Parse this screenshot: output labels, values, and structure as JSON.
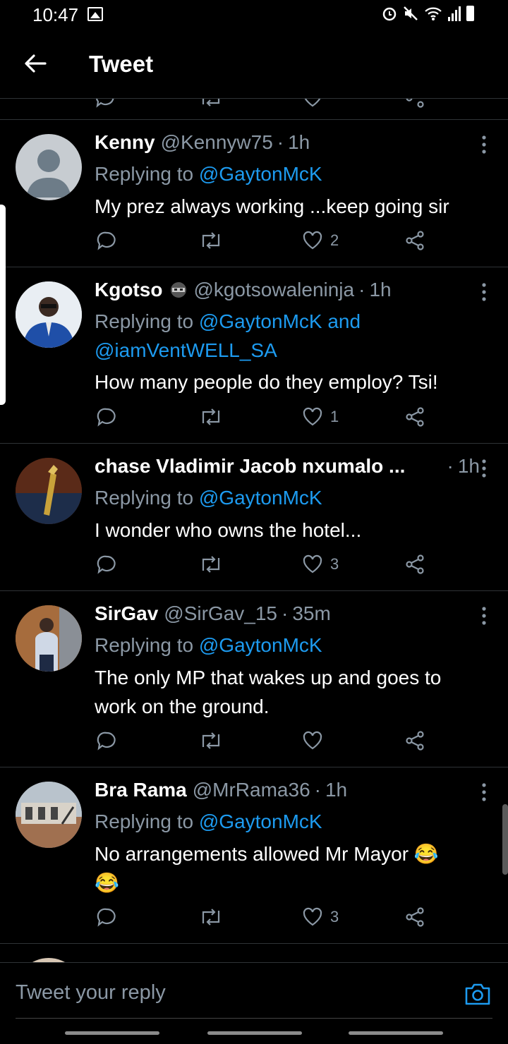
{
  "status_bar": {
    "time": "10:47"
  },
  "header": {
    "title": "Tweet"
  },
  "tweets": [
    {
      "name": "Kenny",
      "handle": "@Kennyw75",
      "time": "1h",
      "replying_prefix": "Replying to ",
      "mentions": "@GaytonMcK",
      "mentions2": "",
      "text": "My prez always working ...keep going sir",
      "text2": "",
      "likes": "2"
    },
    {
      "name": "Kgotso",
      "handle": "@kgotsowaleninja",
      "time": "1h",
      "replying_prefix": "Replying to ",
      "mentions": "@GaytonMcK and",
      "mentions2": "@iamVentWELL_SA",
      "text": "How many people do they employ? Tsi!",
      "text2": "",
      "likes": "1"
    },
    {
      "name": "chase Vladimir Jacob nxumalo ...",
      "handle": "",
      "time": "1h",
      "replying_prefix": "Replying to ",
      "mentions": "@GaytonMcK",
      "mentions2": "",
      "text": "I wonder who owns the hotel...",
      "text2": "",
      "likes": "3"
    },
    {
      "name": "SirGav",
      "handle": "@SirGav_15",
      "time": "35m",
      "replying_prefix": "Replying to ",
      "mentions": "@GaytonMcK",
      "mentions2": "",
      "text": "The only MP that wakes up and goes to",
      "text2": "work on the ground.",
      "likes": ""
    },
    {
      "name": "Bra Rama",
      "handle": "@MrRama36",
      "time": "1h",
      "replying_prefix": "Replying to ",
      "mentions": "@GaytonMcK",
      "mentions2": "",
      "text": "No arrangements allowed Mr Mayor 😂",
      "text2": "😂",
      "likes": "3"
    }
  ],
  "reply_bar": {
    "placeholder": "Tweet your reply"
  },
  "icons": [
    "back-arrow-icon",
    "more-icon",
    "reply-icon",
    "retweet-icon",
    "like-icon",
    "share-icon",
    "camera-icon"
  ],
  "colors": {
    "accent": "#1d9bf0",
    "background": "#000000",
    "secondary_text": "#8b98a5"
  }
}
